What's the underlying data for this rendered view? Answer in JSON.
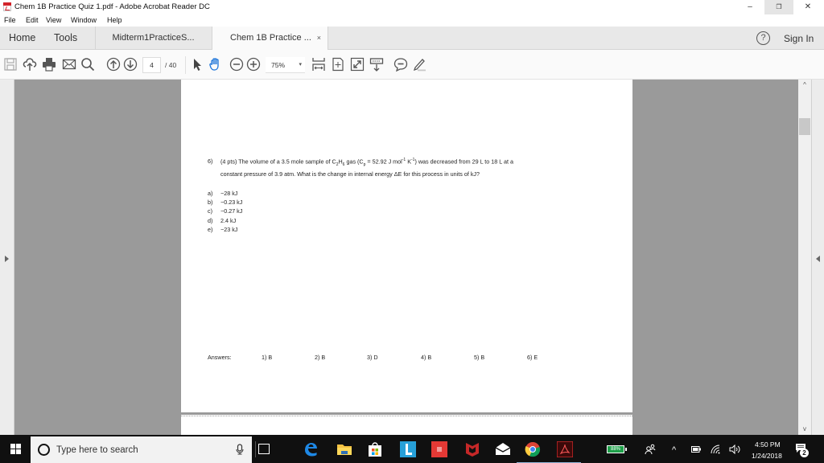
{
  "window": {
    "title": "Chem 1B Practice Quiz 1.pdf - Adobe Acrobat Reader DC",
    "minimize_glyph": "–",
    "restore_glyph": "❐",
    "close_glyph": "✕"
  },
  "menu": [
    "File",
    "Edit",
    "View",
    "Window",
    "Help"
  ],
  "tabs": {
    "home": "Home",
    "tools": "Tools",
    "doc_tabs": [
      {
        "label": "Midterm1PracticeS...",
        "active": false
      },
      {
        "label": "Chem 1B Practice ...",
        "active": true,
        "close_glyph": "×"
      }
    ],
    "help_glyph": "?",
    "sign_in": "Sign In"
  },
  "toolbar": {
    "icons": [
      "save-icon",
      "upload-cloud-icon",
      "print-icon",
      "email-icon",
      "search-icon",
      "page-up-icon",
      "page-down-icon",
      "select-arrow-icon",
      "hand-tool-icon",
      "zoom-out-icon",
      "zoom-in-icon",
      "fit-width-icon",
      "fit-page-icon",
      "full-screen-icon",
      "read-mode-icon",
      "comment-icon",
      "highlight-pen-icon"
    ],
    "current_page": "4",
    "total_pages": "/ 40",
    "zoom": "75%",
    "zoom_caret": "▾"
  },
  "document": {
    "question": {
      "number": "6)",
      "line1_parts": {
        "a": "(4 pts) The volume of a 3.5 mole sample of C",
        "sub1": "2",
        "b": "H",
        "sub2": "6",
        "c": " gas (C",
        "sub3": "p",
        "d": " = 52.92 J mol",
        "sup1": "-1",
        "e": " K",
        "sup2": "-1",
        "f": ") was decreased from 29 L to 18 L at a"
      },
      "line2": "constant pressure of 3.9 atm. What is the change in internal energy ΔE for this process in units of kJ?"
    },
    "choices": [
      {
        "label": "a)",
        "text": "−28 kJ"
      },
      {
        "label": "b)",
        "text": "−0.23 kJ"
      },
      {
        "label": "c)",
        "text": "−0.27 kJ"
      },
      {
        "label": "d)",
        "text": "2.4 kJ"
      },
      {
        "label": "e)",
        "text": "−23 kJ"
      }
    ],
    "answers_label": "Answers:",
    "answers": [
      "1) B",
      "2) B",
      "3) D",
      "4) B",
      "5) B",
      "6) E"
    ]
  },
  "scrollbar": {
    "up_glyph": "^",
    "down_glyph": "v"
  },
  "taskbar": {
    "search_placeholder": "Type here to search",
    "pinned_apps": [
      "edge-icon",
      "file-explorer-icon",
      "store-icon",
      "app-l-icon",
      "red-app-icon",
      "mcafee-icon",
      "mail-icon",
      "chrome-icon",
      "acrobat-icon"
    ],
    "battery_percent": "88%",
    "tray_up_glyph": "^",
    "time": "4:50 PM",
    "date": "1/24/2018",
    "notification_count": "2"
  },
  "colors": {
    "acrobat_red": "#d2232a",
    "doc_bg_gray": "#9a9a9a",
    "taskbar_bg": "#101010",
    "battery_green": "#1fa04a"
  }
}
